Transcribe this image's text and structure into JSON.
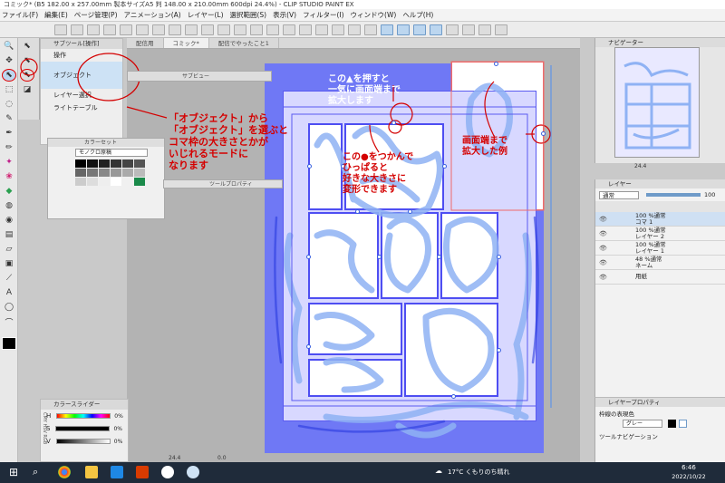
{
  "window_title": "コミック* (B5 182.00 x 257.00mm 製本サイズA5 判 148.00 x 210.00mm 600dpi 24.4%) - CLIP STUDIO PAINT EX",
  "menu": [
    "ファイル(F)",
    "編集(E)",
    "ページ管理(P)",
    "アニメーション(A)",
    "レイヤー(L)",
    "選択範囲(S)",
    "表示(V)",
    "フィルター(I)",
    "ウィンドウ(W)",
    "ヘルプ(H)"
  ],
  "subtool": {
    "header": "サブツール[操作]",
    "items": [
      "操作",
      "オブジェクト",
      "レイヤー選択",
      "ライトテーブル"
    ],
    "selected": "オブジェクト"
  },
  "doc_tabs": [
    "配信用",
    "コミック*",
    "配信でやったこと1"
  ],
  "subview_title": "サブビュー",
  "color_set": {
    "title": "カラーセット",
    "set_name": "モノクロ原稿"
  },
  "tool_property_title": "ツールプロパティ",
  "color_slider": {
    "title": "カラースライダー",
    "rows": [
      {
        "label": "H",
        "value": "0%"
      },
      {
        "label": "S",
        "value": "0%"
      },
      {
        "label": "V",
        "value": "0%"
      }
    ],
    "tabs": "CMY HSV RGB"
  },
  "navigator": {
    "title": "ナビゲーター",
    "zoom": "24.4"
  },
  "layer_panel": {
    "title": "レイヤー",
    "blend_mode": "通常",
    "opacity": "100",
    "layers": [
      {
        "line1": "100 %通常",
        "line2": "コマ 1",
        "selected": true
      },
      {
        "line1": "100 %通常",
        "line2": "レイヤー 2",
        "selected": false
      },
      {
        "line1": "100 %通常",
        "line2": "レイヤー 1",
        "selected": false
      },
      {
        "line1": "48 %通常",
        "line2": "ネーム",
        "selected": false
      },
      {
        "line1": "",
        "line2": "用紙",
        "selected": false
      }
    ]
  },
  "layer_property": {
    "title": "レイヤープロパティ",
    "line_color_label": "枠線の表現色",
    "line_color": "グレー",
    "tool_nav": "ツールナビゲーション"
  },
  "canvas_status": {
    "zoom": "24.4",
    "angle": "0.0"
  },
  "annotations": {
    "object_note": [
      "「オブジェクト」から",
      "「オブジェクト」を選ぶと",
      "コマ枠の大きさとかが",
      "いじれるモードに",
      "なります"
    ],
    "triangle_note": [
      "この▲を押すと",
      "一気に画面端まで",
      "拡大します"
    ],
    "circle_note": [
      "この●をつかんで",
      "ひっぱると",
      "好きな大きさに",
      "変形できます"
    ],
    "edge_note": [
      "画面端まで",
      "拡大した例"
    ]
  },
  "taskbar": {
    "weather": "17°C くもりのち晴れ",
    "time": "6:46",
    "date": "2022/10/22"
  },
  "colors": {
    "page_blue": "#6f78f5",
    "frame_blue": "#4e4ef2",
    "annotation_red": "#d40000",
    "taskbar": "#1f2b3a"
  }
}
